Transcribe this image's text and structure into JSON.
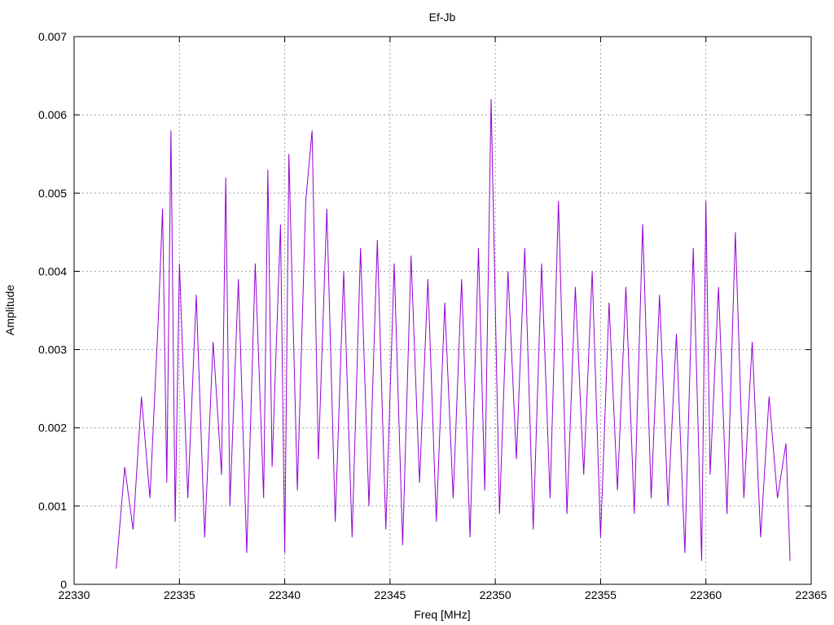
{
  "chart_data": {
    "type": "line",
    "title": "Ef-Jb",
    "xlabel": "Freq [MHz]",
    "ylabel": "Amplitude",
    "xlim": [
      22330,
      22365
    ],
    "ylim": [
      0,
      0.007
    ],
    "xticks": [
      "22330",
      "22335",
      "22340",
      "22345",
      "22350",
      "22355",
      "22360",
      "22365"
    ],
    "yticks": [
      "0",
      "0.001",
      "0.002",
      "0.003",
      "0.004",
      "0.005",
      "0.006",
      "0.007"
    ],
    "grid": true,
    "series_color": "#9400d3",
    "series": [
      {
        "x": [
          22332.0,
          22332.4,
          22332.8,
          22333.2,
          22333.6,
          22334.0,
          22334.2,
          22334.4,
          22334.6,
          22334.8,
          22335.0,
          22335.4,
          22335.8,
          22336.2,
          22336.6,
          22337.0,
          22337.2,
          22337.4,
          22337.8,
          22338.2,
          22338.6,
          22339.0,
          22339.2,
          22339.4,
          22339.8,
          22340.0,
          22340.2,
          22340.6,
          22341.0,
          22341.3,
          22341.6,
          22342.0,
          22342.4,
          22342.8,
          22343.2,
          22343.6,
          22344.0,
          22344.4,
          22344.8,
          22345.2,
          22345.6,
          22346.0,
          22346.4,
          22346.8,
          22347.2,
          22347.6,
          22348.0,
          22348.4,
          22348.8,
          22349.2,
          22349.5,
          22349.8,
          22350.2,
          22350.6,
          22351.0,
          22351.4,
          22351.8,
          22352.2,
          22352.6,
          22353.0,
          22353.4,
          22353.8,
          22354.2,
          22354.6,
          22355.0,
          22355.4,
          22355.8,
          22356.2,
          22356.6,
          22357.0,
          22357.4,
          22357.8,
          22358.2,
          22358.6,
          22359.0,
          22359.4,
          22359.8,
          22360.0,
          22360.2,
          22360.6,
          22361.0,
          22361.4,
          22361.8,
          22362.2,
          22362.6,
          22363.0,
          22363.4,
          22363.8,
          22364.0
        ],
        "y": [
          0.0002,
          0.0015,
          0.0007,
          0.0024,
          0.0011,
          0.0034,
          0.0048,
          0.0013,
          0.0058,
          0.0008,
          0.0041,
          0.0011,
          0.0037,
          0.0006,
          0.0031,
          0.0014,
          0.0052,
          0.001,
          0.0039,
          0.0004,
          0.0041,
          0.0011,
          0.0053,
          0.0015,
          0.0046,
          0.0004,
          0.0055,
          0.0012,
          0.0049,
          0.0058,
          0.0016,
          0.0048,
          0.0008,
          0.004,
          0.0006,
          0.0043,
          0.001,
          0.0044,
          0.0007,
          0.0041,
          0.0005,
          0.0042,
          0.0013,
          0.0039,
          0.0008,
          0.0036,
          0.0011,
          0.0039,
          0.0006,
          0.0043,
          0.0012,
          0.0062,
          0.0009,
          0.004,
          0.0016,
          0.0043,
          0.0007,
          0.0041,
          0.0011,
          0.0049,
          0.0009,
          0.0038,
          0.0014,
          0.004,
          0.0006,
          0.0036,
          0.0012,
          0.0038,
          0.0009,
          0.0046,
          0.0011,
          0.0037,
          0.001,
          0.0032,
          0.0004,
          0.0043,
          0.0003,
          0.0049,
          0.0014,
          0.0038,
          0.0009,
          0.0045,
          0.0011,
          0.0031,
          0.0006,
          0.0024,
          0.0011,
          0.0018,
          0.0003
        ]
      }
    ]
  }
}
